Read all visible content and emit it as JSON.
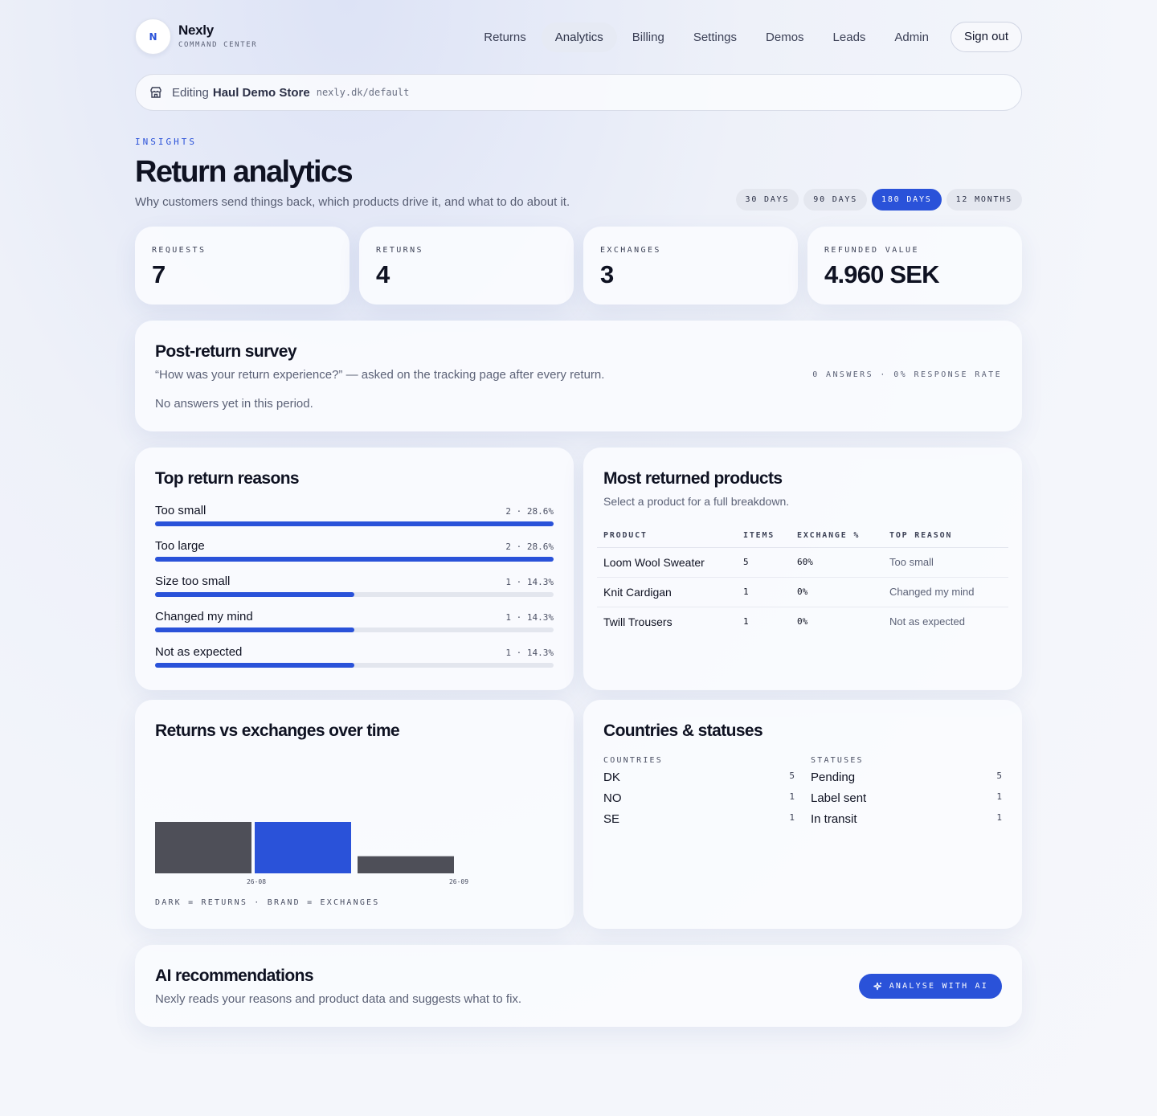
{
  "brand": {
    "name": "Nexly",
    "subtitle": "COMMAND CENTER",
    "logo_glyph": "N"
  },
  "nav": {
    "items": [
      "Returns",
      "Analytics",
      "Billing",
      "Settings",
      "Demos",
      "Leads",
      "Admin"
    ],
    "active": "Analytics",
    "signout": "Sign out"
  },
  "editing": {
    "prefix": "Editing",
    "store": "Haul Demo Store",
    "domain": "nexly.dk/default",
    "icon": "store-icon"
  },
  "header": {
    "eyebrow": "INSIGHTS",
    "title": "Return analytics",
    "subtitle": "Why customers send things back, which products drive it, and what to do about it."
  },
  "ranges": {
    "items": [
      "30 DAYS",
      "90 DAYS",
      "180 DAYS",
      "12 MONTHS"
    ],
    "active": "180 DAYS"
  },
  "stats": [
    {
      "label": "REQUESTS",
      "value": "7"
    },
    {
      "label": "RETURNS",
      "value": "4"
    },
    {
      "label": "EXCHANGES",
      "value": "3"
    },
    {
      "label": "REFUNDED VALUE",
      "value": "4.960 SEK"
    }
  ],
  "survey": {
    "title": "Post-return survey",
    "question": "“How was your return experience?” — asked on the tracking page after every return.",
    "rate": "0 ANSWERS · 0% RESPONSE RATE",
    "empty": "No answers yet in this period."
  },
  "reasons": {
    "title": "Top return reasons",
    "items": [
      {
        "name": "Too small",
        "count": "2 · 28.6%",
        "fill": 1.0
      },
      {
        "name": "Too large",
        "count": "2 · 28.6%",
        "fill": 1.0
      },
      {
        "name": "Size too small",
        "count": "1 · 14.3%",
        "fill": 0.5
      },
      {
        "name": "Changed my mind",
        "count": "1 · 14.3%",
        "fill": 0.5
      },
      {
        "name": "Not as expected",
        "count": "1 · 14.3%",
        "fill": 0.5
      }
    ]
  },
  "products": {
    "title": "Most returned products",
    "subtitle": "Select a product for a full breakdown.",
    "columns": [
      "PRODUCT",
      "ITEMS",
      "EXCHANGE %",
      "TOP REASON"
    ],
    "rows": [
      [
        "Loom Wool Sweater",
        "5",
        "60%",
        "Too small"
      ],
      [
        "Knit Cardigan",
        "1",
        "0%",
        "Changed my mind"
      ],
      [
        "Twill Trousers",
        "1",
        "0%",
        "Not as expected"
      ]
    ]
  },
  "timeline": {
    "title": "Returns vs exchanges over time",
    "legend": "DARK = RETURNS · BRAND = EXCHANGES"
  },
  "chart_data": {
    "type": "bar",
    "categories": [
      "26-08",
      "26-09"
    ],
    "series": [
      {
        "name": "RETURNS",
        "values": [
          3,
          1
        ],
        "color": "#4e4f58"
      },
      {
        "name": "EXCHANGES",
        "values": [
          3,
          0
        ],
        "color": "#2a52d9"
      }
    ],
    "ylim": [
      0,
      3
    ],
    "title": "",
    "xlabel": "",
    "ylabel": ""
  },
  "countries_statuses": {
    "title": "Countries & statuses",
    "countries_label": "COUNTRIES",
    "statuses_label": "STATUSES",
    "countries": [
      {
        "name": "DK",
        "count": "5"
      },
      {
        "name": "NO",
        "count": "1"
      },
      {
        "name": "SE",
        "count": "1"
      }
    ],
    "statuses": [
      {
        "name": "Pending",
        "count": "5"
      },
      {
        "name": "Label sent",
        "count": "1"
      },
      {
        "name": "In transit",
        "count": "1"
      }
    ]
  },
  "ai": {
    "title": "AI recommendations",
    "subtitle": "Nexly reads your reasons and product data and suggests what to fix.",
    "button": "ANALYSE WITH AI",
    "button_icon": "sparkle-icon"
  }
}
